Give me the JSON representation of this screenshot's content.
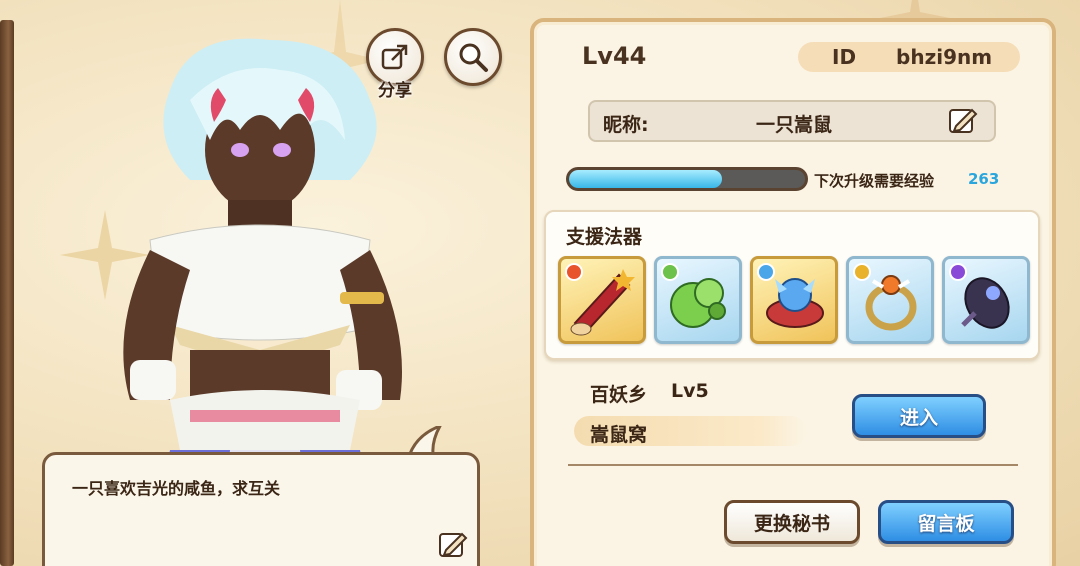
{
  "profile": {
    "level": "Lv44",
    "id_label": "ID",
    "id_value": "bhzi9nm",
    "nickname_label": "昵称:",
    "nickname": "一只嵩鼠",
    "exp_label": "下次升级需要经验",
    "exp_value": "263",
    "exp_progress": 0.65
  },
  "toolbar": {
    "share_label": "分享",
    "share_icon": "share-icon",
    "search_icon": "search-icon"
  },
  "support": {
    "title": "支援法器",
    "items": [
      {
        "name": "red-scroll-item",
        "element_color": "#e8542c",
        "frame": "gold"
      },
      {
        "name": "green-plant-item",
        "element_color": "#6cc24a",
        "frame": "blue"
      },
      {
        "name": "blue-fairy-item",
        "element_color": "#4aa6e8",
        "frame": "gold"
      },
      {
        "name": "gold-ring-item",
        "element_color": "#e8b22c",
        "frame": "blue"
      },
      {
        "name": "dark-orb-item",
        "element_color": "#8a4ad8",
        "frame": "blue"
      }
    ]
  },
  "village": {
    "name": "百妖乡",
    "level": "Lv5",
    "subname": "嵩鼠窝",
    "enter_label": "进入"
  },
  "bubble": {
    "text": "一只喜欢吉光的咸鱼，求互关"
  },
  "buttons": {
    "swap_label": "更换秘书",
    "board_label": "留言板"
  },
  "colors": {
    "accent_blue": "#2aa6dd",
    "panel_border": "#d9b47c",
    "text_dark": "#3b2616"
  }
}
